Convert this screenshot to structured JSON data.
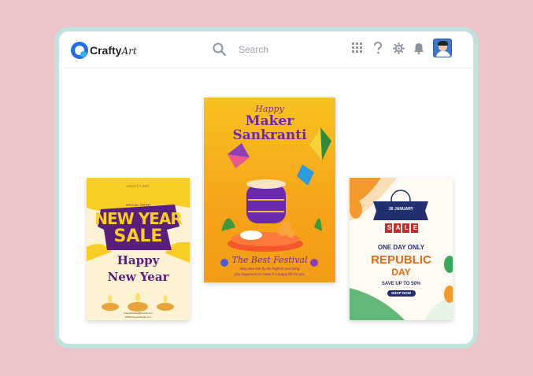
{
  "app": {
    "name": "Crafty",
    "name_suffix": "Art"
  },
  "search": {
    "placeholder": "Search"
  },
  "toolbar": {
    "icons": [
      "apps-grid-icon",
      "help-icon",
      "settings-icon",
      "bell-icon"
    ]
  },
  "colors": {
    "background": "#ebc5c7",
    "brand": "#1f6fe5"
  },
  "templates": [
    {
      "brand": "CRAFTY ART",
      "tag": "SPECIAL OFFER",
      "headline_1": "NEW YEAR",
      "headline_2": "SALE",
      "greeting_1": "Happy",
      "greeting_2": "New Year",
      "footer_1": "hopeartstudio@flomail.com",
      "footer_2": "WWW.hopeartstudio.com"
    },
    {
      "title_1": "Happy",
      "title_2": "Maker",
      "title_3": "Sankranti",
      "subtitle": "The Best Festival",
      "tagline_1": "May your kite fly the highest and bring",
      "tagline_2": "you happiness to make it a happy life for you"
    },
    {
      "date_banner": "26 JANUARY",
      "sale_letters": [
        "S",
        "A",
        "L",
        "E"
      ],
      "offer": "ONE DAY ONLY",
      "title_1": "REPUBLIC",
      "title_2": "DAY",
      "discount": "SAVE UP TO 50%",
      "cta": "SHOP NOW"
    }
  ]
}
